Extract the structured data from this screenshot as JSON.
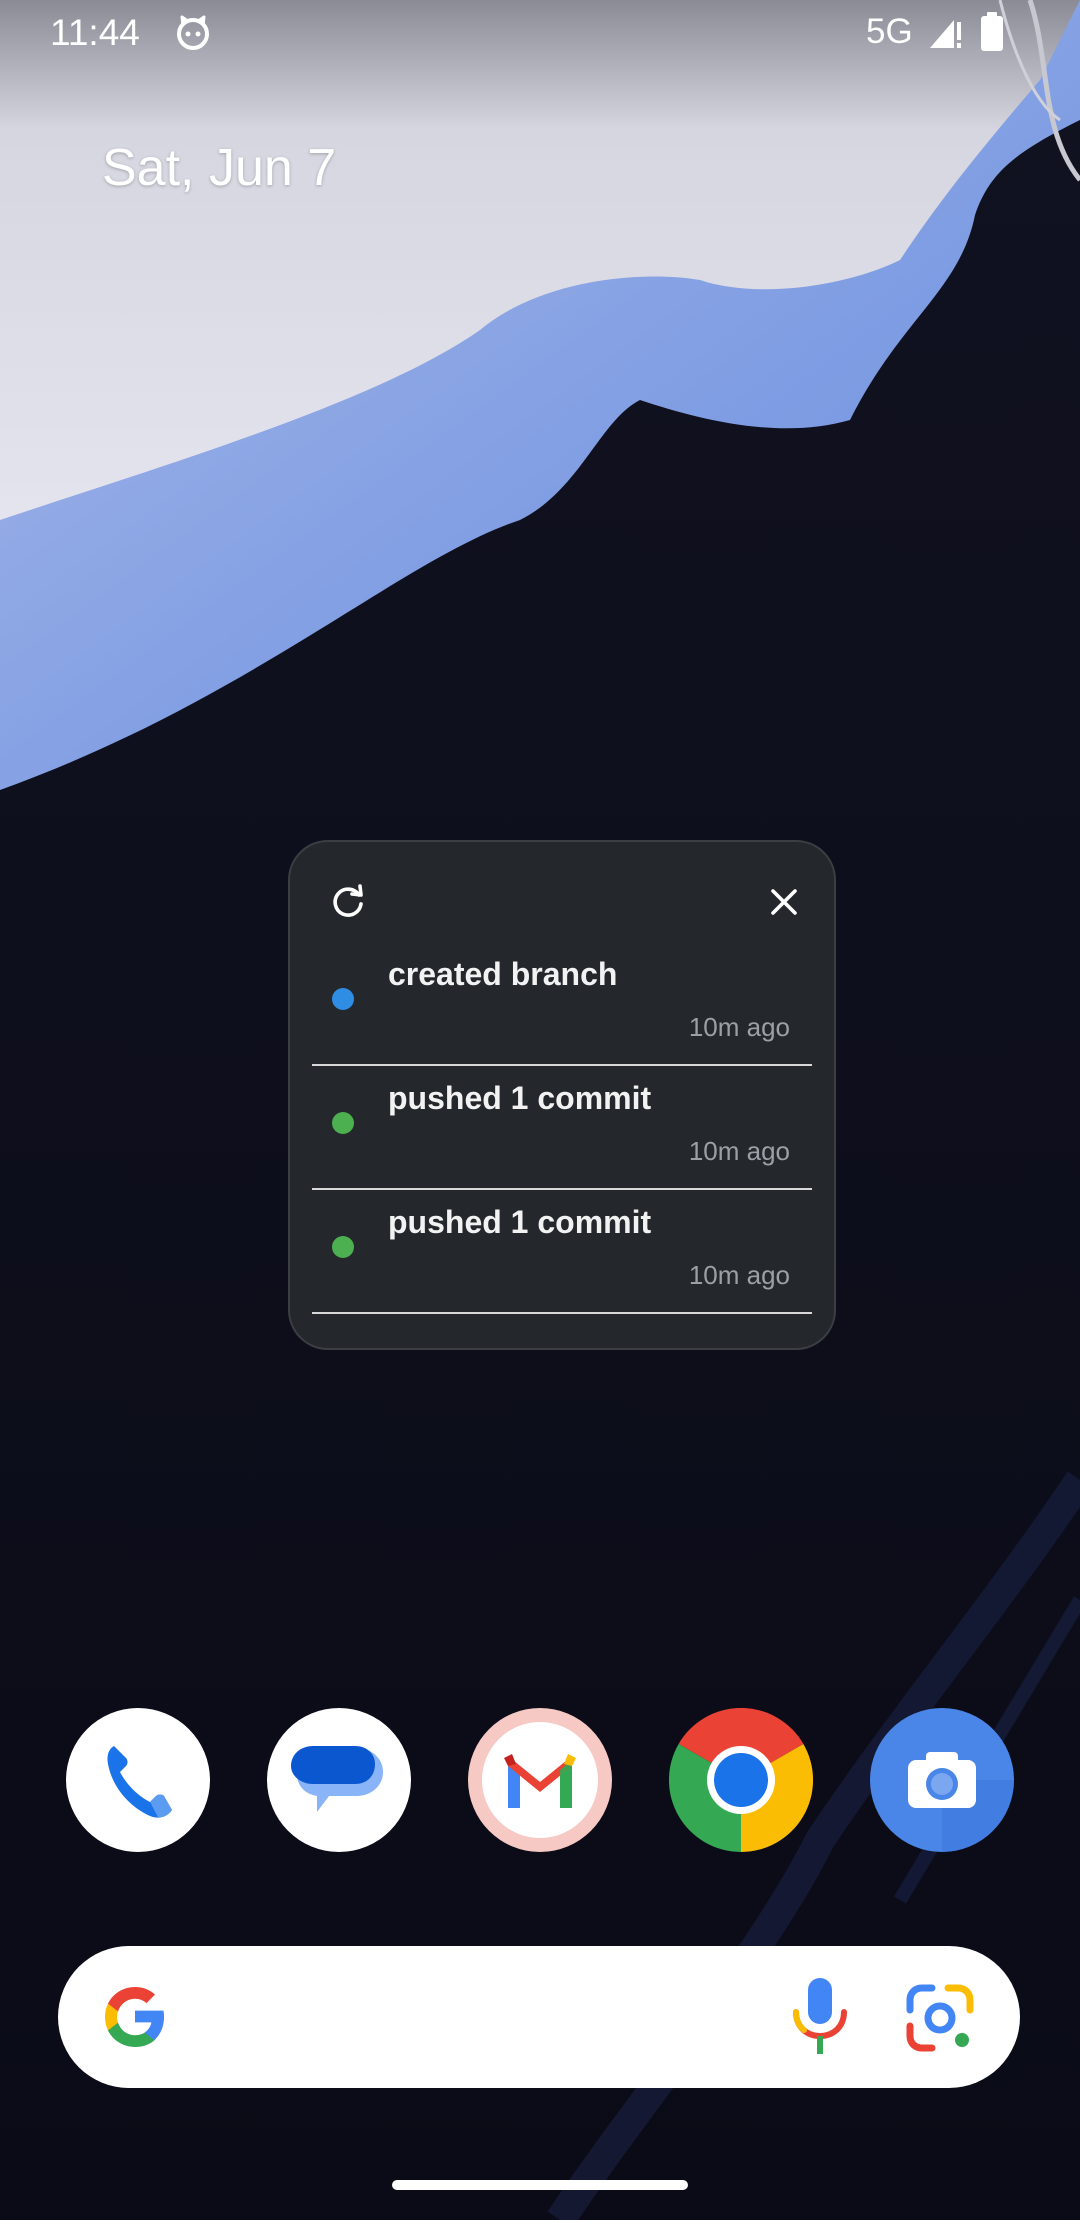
{
  "status_bar": {
    "time": "11:44",
    "network": "5G",
    "app_icon": "cat-face-icon",
    "signal_icon": "cellular-signal-icon",
    "battery_icon": "battery-icon"
  },
  "home": {
    "date": "Sat, Jun 7"
  },
  "widget": {
    "refresh_icon": "refresh-icon",
    "close_icon": "close-icon",
    "items": [
      {
        "title": "created branch",
        "time": "10m ago",
        "dot_color": "#2f8de4"
      },
      {
        "title": "pushed 1 commit",
        "time": "10m ago",
        "dot_color": "#4caf50"
      },
      {
        "title": "pushed 1 commit",
        "time": "10m ago",
        "dot_color": "#4caf50"
      }
    ]
  },
  "dock": {
    "apps": [
      "phone-icon",
      "messages-icon",
      "gmail-icon",
      "chrome-icon",
      "camera-icon"
    ]
  },
  "search": {
    "logo_icon": "google-g-icon",
    "mic_icon": "microphone-icon",
    "lens_icon": "google-lens-icon"
  },
  "colors": {
    "widget_background": "#24272b",
    "accent_blue": "#2f8de4",
    "accent_green": "#4caf50"
  }
}
